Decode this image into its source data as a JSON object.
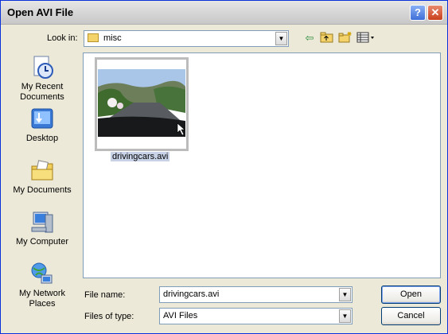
{
  "window": {
    "title": "Open AVI File"
  },
  "lookin": {
    "label": "Look in:",
    "value": "misc"
  },
  "places": [
    {
      "label": "My Recent Documents"
    },
    {
      "label": "Desktop"
    },
    {
      "label": "My Documents"
    },
    {
      "label": "My Computer"
    },
    {
      "label": "My Network Places"
    }
  ],
  "files": [
    {
      "name": "drivingcars.avi"
    }
  ],
  "filename": {
    "label": "File name:",
    "value": "drivingcars.avi"
  },
  "filetype": {
    "label": "Files of type:",
    "value": "AVI Files"
  },
  "buttons": {
    "open": "Open",
    "cancel": "Cancel"
  },
  "colors": {
    "titlebar": "#d8d8d8",
    "dialog_bg": "#ece9d8",
    "selection": "#c8d2e6"
  }
}
